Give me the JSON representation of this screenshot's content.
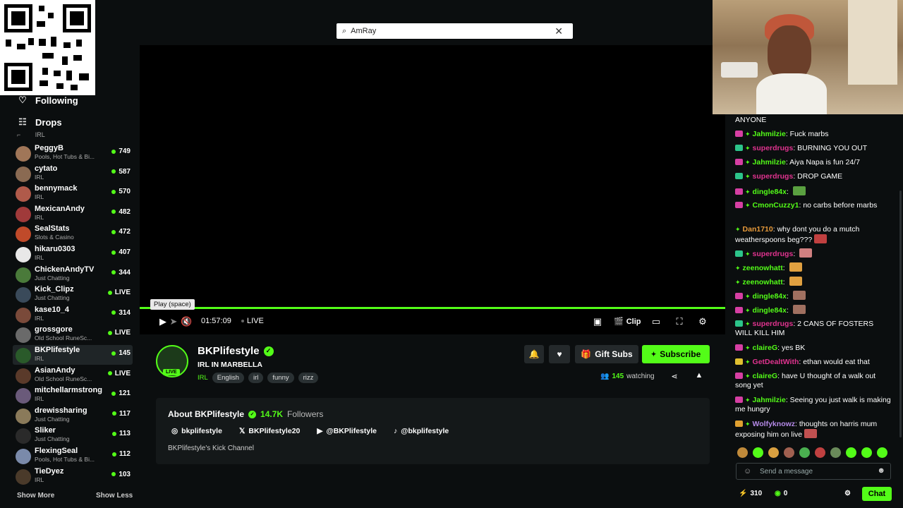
{
  "search": {
    "query": "AmRay"
  },
  "sidebar": {
    "following_label": "Following",
    "drops_label": "Drops",
    "stub_category": "IRL",
    "channels": [
      {
        "name": "PeggyB",
        "category": "Pools, Hot Tubs & Bi...",
        "viewers": "749",
        "avatar_color": "#a07658"
      },
      {
        "name": "cytato",
        "category": "IRL",
        "viewers": "587",
        "avatar_color": "#8a6a52"
      },
      {
        "name": "bennymack",
        "category": "IRL",
        "viewers": "570",
        "avatar_color": "#b05a4a"
      },
      {
        "name": "MexicanAndy",
        "category": "IRL",
        "viewers": "482",
        "avatar_color": "#a03a3a"
      },
      {
        "name": "SealStats",
        "category": "Slots & Casino",
        "viewers": "472",
        "avatar_color": "#c04a2a"
      },
      {
        "name": "hikaru0303",
        "category": "IRL",
        "viewers": "407",
        "avatar_color": "#e8e8e8"
      },
      {
        "name": "ChickenAndyTV",
        "category": "Just Chatting",
        "viewers": "344",
        "avatar_color": "#4a7a3a"
      },
      {
        "name": "Kick_Clipz",
        "category": "Just Chatting",
        "viewers": "LIVE",
        "avatar_color": "#3a4a5a"
      },
      {
        "name": "kase10_4",
        "category": "IRL",
        "viewers": "314",
        "avatar_color": "#7a4a3a"
      },
      {
        "name": "grossgore",
        "category": "Old School RuneSc...",
        "viewers": "LIVE",
        "avatar_color": "#6a6a6a"
      },
      {
        "name": "BKPlifestyle",
        "category": "IRL",
        "viewers": "145",
        "avatar_color": "#2a5a2a",
        "selected": true
      },
      {
        "name": "AsianAndy",
        "category": "Old School RuneSc...",
        "viewers": "LIVE",
        "avatar_color": "#5a3a2a"
      },
      {
        "name": "mitchellarmstrong",
        "category": "IRL",
        "viewers": "121",
        "avatar_color": "#6a5a7a"
      },
      {
        "name": "drewissharing",
        "category": "Just Chatting",
        "viewers": "117",
        "avatar_color": "#8a7a5a"
      },
      {
        "name": "Sliker",
        "category": "Just Chatting",
        "viewers": "113",
        "avatar_color": "#2a2a2a"
      },
      {
        "name": "FlexingSeal",
        "category": "Pools, Hot Tubs & Bi...",
        "viewers": "112",
        "avatar_color": "#7a8aaa"
      },
      {
        "name": "TieDyez",
        "category": "IRL",
        "viewers": "103",
        "avatar_color": "#4a3a2a"
      }
    ],
    "show_more": "Show More",
    "show_less": "Show Less"
  },
  "player": {
    "tooltip": "Play (space)",
    "time": "01:57:09",
    "live_label": "LIVE",
    "clip_label": "Clip"
  },
  "channel": {
    "name": "BKPlifestyle",
    "live_badge": "LIVE",
    "stream_title": "IRL IN MARBELLA",
    "category": "IRL",
    "tags": [
      "English",
      "irl",
      "funny",
      "rizz"
    ],
    "gift_subs": "Gift Subs",
    "subscribe": "Subscribe",
    "watching_count": "145",
    "watching_label": "watching"
  },
  "about": {
    "title": "About BKPlifestyle",
    "followers_count": "14.7K",
    "followers_label": "Followers",
    "socials": [
      {
        "icon": "instagram-icon",
        "glyph": "◎",
        "handle": "bkplifestyle"
      },
      {
        "icon": "x-icon",
        "glyph": "𝕏",
        "handle": "BKPlifestyle20"
      },
      {
        "icon": "youtube-icon",
        "glyph": "▶",
        "handle": "@BKPlifestyle"
      },
      {
        "icon": "tiktok-icon",
        "glyph": "♪",
        "handle": "@bkplifestyle"
      }
    ],
    "description": "BKPlifestyle's Kick Channel"
  },
  "chat": {
    "messages": [
      {
        "user": "",
        "text": "ANYONE",
        "color": "#ffffff",
        "badge": ""
      },
      {
        "user": "Jahmilzie",
        "text": "Fuck marbs",
        "color": "#53fc18",
        "badge": "#d63fa3"
      },
      {
        "user": "superdrugs",
        "text": "BURNING YOU OUT",
        "color": "#e0338f",
        "badge": "#2cc48a"
      },
      {
        "user": "Jahmilzie",
        "text": "Aiya Napa is fun 24/7",
        "color": "#53fc18",
        "badge": "#d63fa3"
      },
      {
        "user": "superdrugs",
        "text": "DROP GAME",
        "color": "#e0338f",
        "badge": "#2cc48a"
      },
      {
        "user": "dingle84x",
        "text": "",
        "color": "#53fc18",
        "badge": "#d63fa3",
        "emote": "#5aa040"
      },
      {
        "user": "CmonCuzzy1",
        "text": "no carbs before marbs",
        "color": "#53fc18",
        "badge": "#d63fa3"
      },
      {
        "user": "Dan1710",
        "text": "why dont you do a mutch weatherspoons beg???",
        "color": "#e89a3a",
        "badge": "",
        "emote": "#c04040"
      },
      {
        "user": "superdrugs",
        "text": "",
        "color": "#e0338f",
        "badge": "#2cc48a",
        "emote": "#d08080"
      },
      {
        "user": "zeenowhatt",
        "text": "",
        "color": "#53fc18",
        "badge": "",
        "emote": "#e0a040"
      },
      {
        "user": "zeenowhatt",
        "text": "",
        "color": "#53fc18",
        "badge": "",
        "emote": "#e0a040"
      },
      {
        "user": "dingle84x",
        "text": "",
        "color": "#53fc18",
        "badge": "#d63fa3",
        "emote": "#a07060"
      },
      {
        "user": "dingle84x",
        "text": "",
        "color": "#53fc18",
        "badge": "#d63fa3",
        "emote": "#a07060"
      },
      {
        "user": "superdrugs",
        "text": "2 CANS OF FOSTERS WILL KILL HIM",
        "color": "#e0338f",
        "badge": "#2cc48a"
      },
      {
        "user": "claireG",
        "text": "yes BK",
        "color": "#53fc18",
        "badge": "#d63fa3"
      },
      {
        "user": "GetDealtWith",
        "text": "ethan would eat that",
        "color": "#e0338f",
        "badge": "#e0c030"
      },
      {
        "user": "claireG",
        "text": "have U thought of a walk out song yet",
        "color": "#53fc18",
        "badge": "#d63fa3"
      },
      {
        "user": "Jahmilzie",
        "text": "Seeing you just walk is making me hungry",
        "color": "#53fc18",
        "badge": "#d63fa3"
      },
      {
        "user": "Wolfyknowz",
        "text": "thoughts on harris mum exposing him on live",
        "color": "#b58ae8",
        "badge": "#e0a030",
        "emote": "#c05050"
      }
    ],
    "input_placeholder": "Send a message",
    "points": "310",
    "zero": "0",
    "chat_button": "Chat"
  },
  "colors": {
    "accent": "#53fc18",
    "bg": "#0b0e0f"
  }
}
